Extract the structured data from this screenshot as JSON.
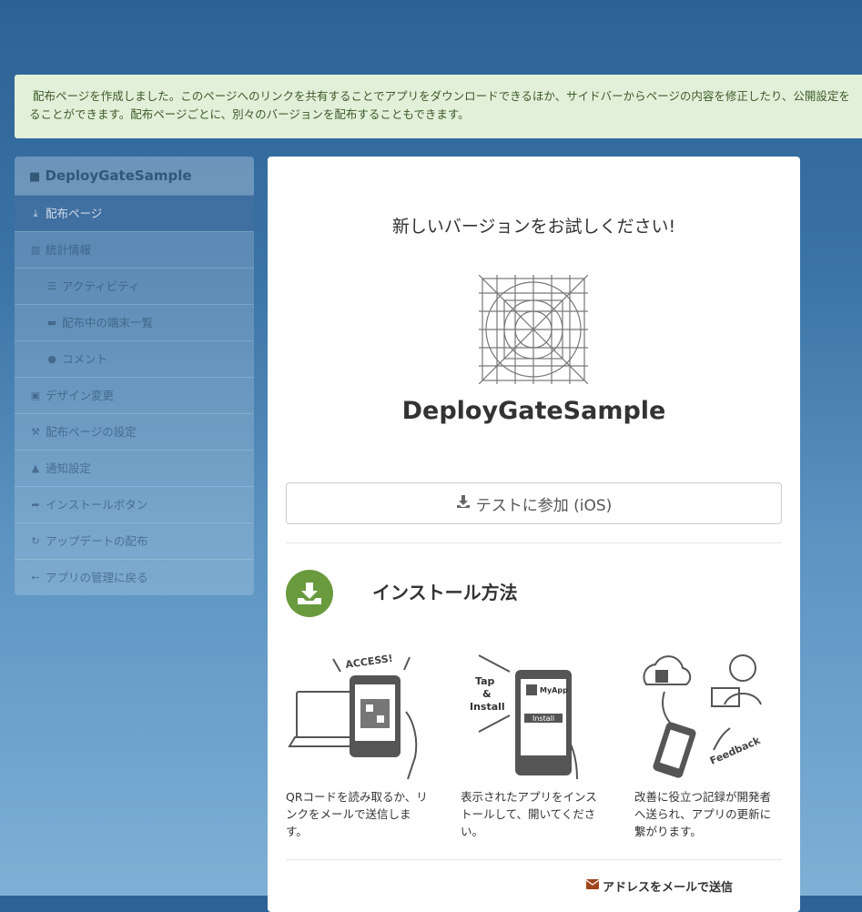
{
  "alert": {
    "line1": "配布ページを作成しました。このページへのリンクを共有することでアプリをダウンロードできるほか、サイドバーからページの内容を修正したり、公開設定を",
    "line2": "ることができます。配布ページごとに、別々のバージョンを配布することもできます。"
  },
  "sidebar": {
    "title": "DeployGateSample",
    "items": [
      {
        "label": "配布ページ",
        "icon": "download-icon"
      },
      {
        "label": "統計情報",
        "icon": "bar-chart-icon"
      },
      {
        "label": "アクティビティ",
        "icon": "list-icon"
      },
      {
        "label": "配布中の端末一覧",
        "icon": "briefcase-icon"
      },
      {
        "label": "コメント",
        "icon": "comment-icon"
      },
      {
        "label": "デザイン変更",
        "icon": "picture-icon"
      },
      {
        "label": "配布ページの設定",
        "icon": "wrench-icon"
      },
      {
        "label": "通知設定",
        "icon": "bell-icon"
      },
      {
        "label": "インストールボタン",
        "icon": "share-icon"
      },
      {
        "label": "アップデートの配布",
        "icon": "refresh-icon"
      },
      {
        "label": "アプリの管理に戻る",
        "icon": "arrow-left-icon"
      }
    ]
  },
  "main": {
    "headline": "新しいバージョンをお試しください!",
    "app_name": "DeployGateSample",
    "join_button": "テストに参加 (iOS)",
    "howto_title": "インストール方法",
    "steps": [
      {
        "text": "QRコードを読み取るか、リンクをメールで送信します。",
        "img_text": "ACCESS!"
      },
      {
        "text": "表示されたアプリをインストールして、開いてください。",
        "img_text_1": "Tap",
        "img_text_2": "&",
        "img_text_3": "Install",
        "img_app": "MyApp",
        "img_install": "Install"
      },
      {
        "text": "改善に役立つ記録が開発者へ送られ、アプリの更新に繋がります。",
        "img_text": "Feedback"
      }
    ],
    "email_link": "アドレスをメールで送信"
  }
}
